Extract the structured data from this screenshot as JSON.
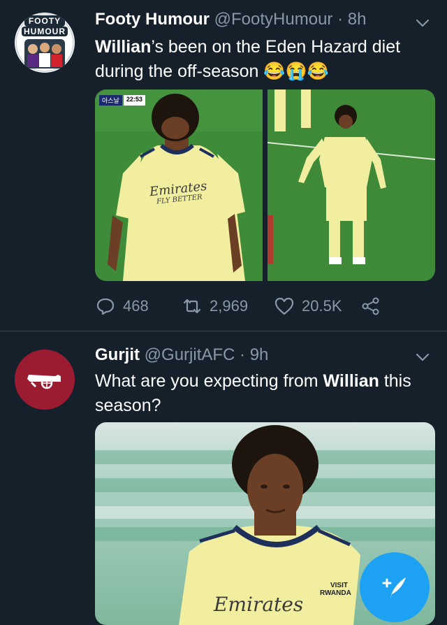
{
  "tweets": [
    {
      "display_name": "Footy Humour",
      "handle": "@FootyHumour",
      "time": "· 8h",
      "text_bold": "Willian",
      "text_rest": "’s been on the Eden Hazard diet during the off-season",
      "emojis": "😂😭😂",
      "avatar_text_line1": "FOOTY",
      "avatar_text_line2": "HUMOUR",
      "media_overlay": {
        "channel": "아스날",
        "clock": "22:53"
      },
      "shirt_text_left": "Emirates",
      "shirt_sub_left": "FLY BETTER",
      "stats": {
        "replies": "468",
        "retweets": "2,969",
        "likes": "20.5K"
      }
    },
    {
      "display_name": "Gurjit",
      "handle": "@GurjitAFC",
      "time": "· 9h",
      "text_start": "What are you expecting from ",
      "text_bold": "Willian",
      "text_end": " this season?",
      "shirt_text": "Emirates",
      "sponsor_text": "VISIT RWANDA"
    }
  ],
  "icons": {
    "chevron": "chevron-down-icon",
    "reply": "reply-icon",
    "retweet": "retweet-icon",
    "like": "heart-icon",
    "share": "share-icon",
    "compose": "compose-tweet-icon"
  },
  "colors": {
    "background": "#15202b",
    "secondary_text": "#8899a6",
    "accent": "#1da1f2",
    "arsenal_red": "#9b1c31",
    "kit_yellow": "#f2ee9f",
    "pitch_green": "#3e8b3a"
  }
}
